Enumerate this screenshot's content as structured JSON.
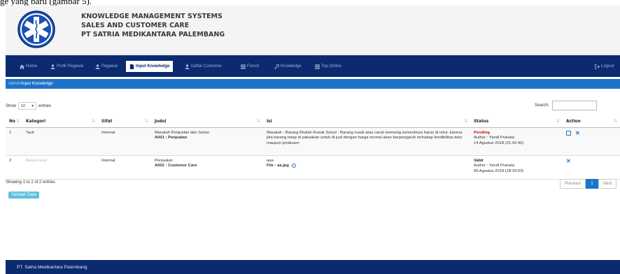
{
  "caption": "ge yang baru (gambar 5).",
  "brand": {
    "line1": "KNOWLEDGE MANAGEMENT SYSTEMS",
    "line2": "SALES AND CUSTOMER CARE",
    "line3": "PT SATRIA MEDIKANTARA PALEMBANG"
  },
  "nav": {
    "items": [
      "Home",
      "Profil Pegawai",
      "Pegawai",
      "Input Knowledge",
      "Daftar Customer",
      "Forum",
      "Knowledge",
      "Top Online"
    ],
    "logout": "Logout"
  },
  "breadcrumb": {
    "parent": "Admin",
    "sep": " / ",
    "current": "Input Knowledge"
  },
  "controls": {
    "show": "Show",
    "entries_value": "10",
    "entries": "entries",
    "search_label": "Search:"
  },
  "table": {
    "headers": [
      "No",
      "Kategori",
      "Sifat",
      "Judul",
      "Isi",
      "Status",
      "Action"
    ],
    "rows": [
      {
        "no": "1",
        "kategori": "Tack",
        "sifat": "Internal",
        "judul_title": "Masalah Penjualan dan Solusi",
        "judul_code": "A001 : Penjualan",
        "isi": "Masalah : Barang Mudah Rusak Solusi : Barang rusak atau cacat memang semestinya harus di retur. karena jika barang tetap di paksakan untuk di jual dengan harga normal akan berpengaruh terhadap kredibilitas toko maupun produsen",
        "status": "Pending",
        "author": "Author : Yandi Pranata",
        "date": "14 Agustus 2018  (21:42:42)"
      },
      {
        "no": "2",
        "kategori": "Belum diset",
        "sifat": "Internal",
        "judul_title": "Penjualan",
        "judul_code": "A002 : Customer Care",
        "isi": "aaa",
        "file": "File : aa.jpg",
        "status": "Valid",
        "author": "Author : Yandi Pranata",
        "date": "06 Agustus 2018  (18:29:53)"
      }
    ]
  },
  "showing": "Showing 1 to 2 of 2 entries",
  "add_button": "Tambah Data",
  "pagination": {
    "previous": "Previous",
    "current": "1",
    "next": "Next"
  },
  "footer": "PT. Satria Medikantara Palembang",
  "colors": {
    "navbar": "#0b2a6f",
    "accent": "#1e73c9",
    "pending": "#e00000"
  }
}
